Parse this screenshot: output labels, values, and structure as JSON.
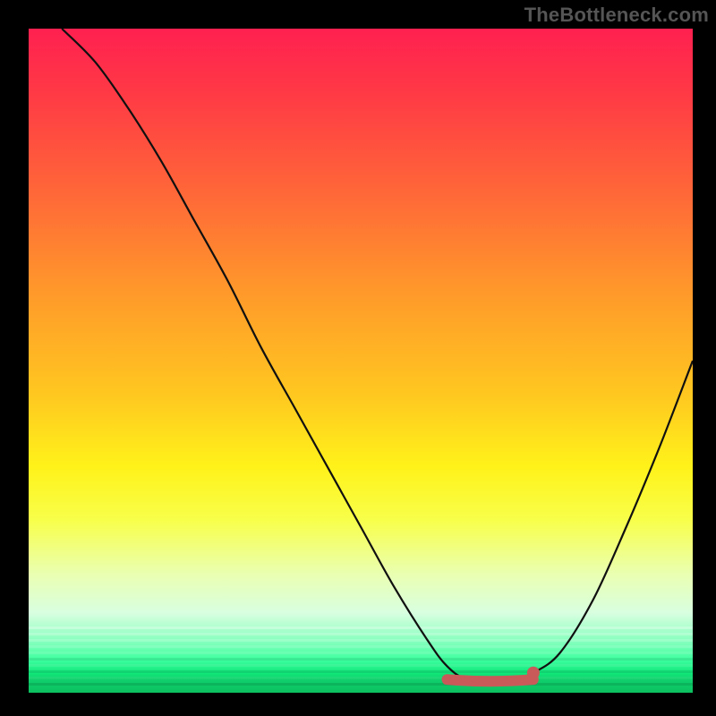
{
  "watermark": "TheBottleneck.com",
  "colors": {
    "frame_background": "#000000",
    "watermark_text": "#555555",
    "curve_stroke": "#101010",
    "highlight_segment": "#c85a5a",
    "highlight_dot": "#c85a5a",
    "gradient_stops": [
      "#ff2050",
      "#ff3a45",
      "#ff6838",
      "#ff9a2a",
      "#ffc720",
      "#fff21a",
      "#f8ff4a",
      "#eaffb0",
      "#d8ffe0",
      "#8cffc0",
      "#3effa0",
      "#11e87a",
      "#0fd06c",
      "#0cc060"
    ]
  },
  "chart_data": {
    "type": "line",
    "title": "",
    "xlabel": "",
    "ylabel": "",
    "xlim": [
      0,
      100
    ],
    "ylim": [
      0,
      100
    ],
    "grid": false,
    "legend": false,
    "background": "vertical red→yellow→green gradient (value decreases toward minimum)",
    "series": [
      {
        "name": "bottleneck-curve",
        "x": [
          5,
          10,
          15,
          20,
          25,
          30,
          35,
          40,
          45,
          50,
          55,
          60,
          63,
          66,
          70,
          73,
          76,
          80,
          85,
          90,
          95,
          100
        ],
        "y": [
          100,
          95,
          88,
          80,
          71,
          62,
          52,
          43,
          34,
          25,
          16,
          8,
          4,
          2,
          2,
          2,
          3,
          6,
          14,
          25,
          37,
          50
        ]
      }
    ],
    "highlight": {
      "name": "optimal-range",
      "x_range": [
        63,
        76
      ],
      "y": 2,
      "note": "flat minimum region drawn as thick red segment"
    },
    "highlight_point": {
      "x": 76,
      "y": 3
    }
  }
}
